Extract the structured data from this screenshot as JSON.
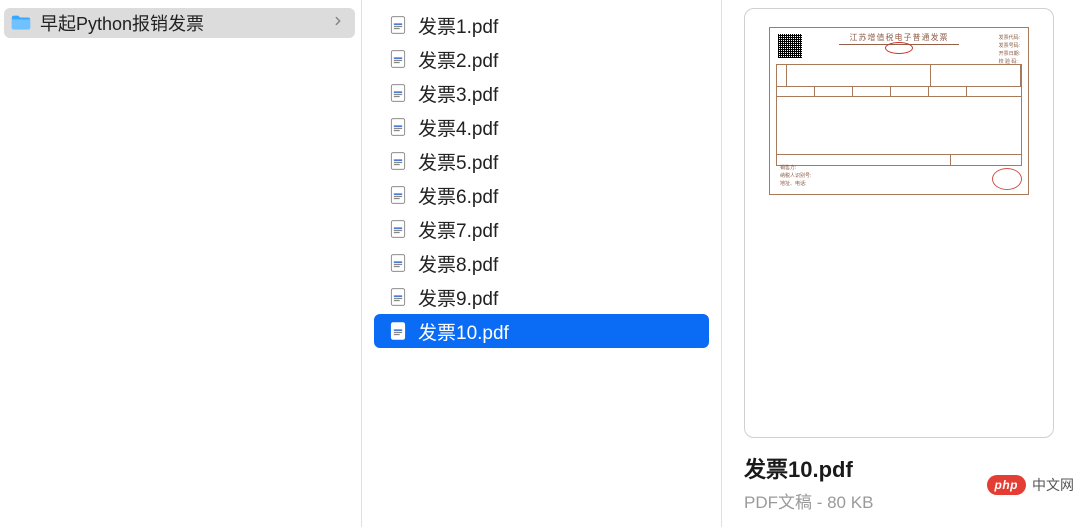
{
  "sidebar": {
    "folder_label": "早起Python报销发票"
  },
  "files": [
    {
      "name": "发票1.pdf"
    },
    {
      "name": "发票2.pdf"
    },
    {
      "name": "发票3.pdf"
    },
    {
      "name": "发票4.pdf"
    },
    {
      "name": "发票5.pdf"
    },
    {
      "name": "发票6.pdf"
    },
    {
      "name": "发票7.pdf"
    },
    {
      "name": "发票8.pdf"
    },
    {
      "name": "发票9.pdf"
    },
    {
      "name": "发票10.pdf"
    }
  ],
  "selected_index": 9,
  "preview": {
    "filename": "发票10.pdf",
    "meta": "PDF文稿 - 80 KB",
    "invoice_title": "江苏增值税电子普通发票"
  },
  "watermark": {
    "pill": "php",
    "text": "中文网"
  }
}
